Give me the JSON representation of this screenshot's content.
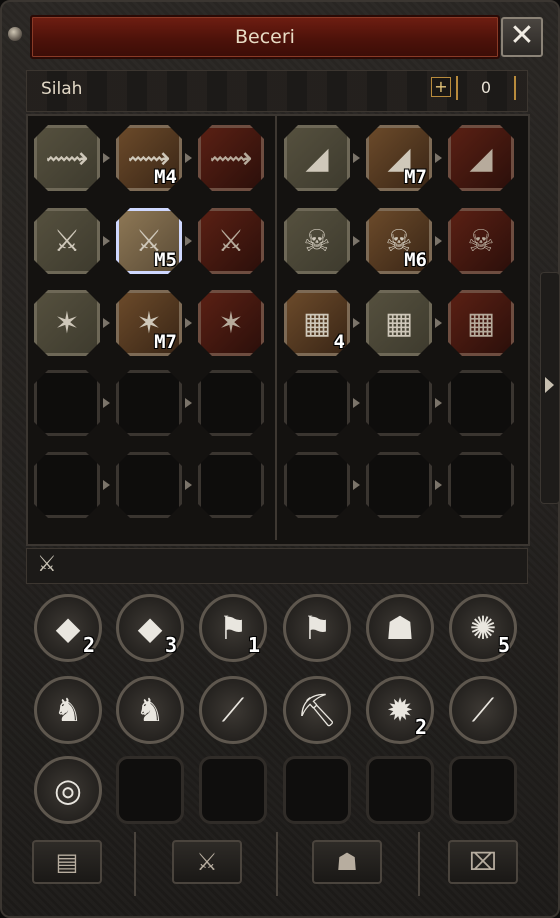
{
  "window": {
    "title": "Beceri",
    "close_glyph": "✕"
  },
  "category": {
    "label": "Silah",
    "plus_glyph": "+",
    "points": "0"
  },
  "left_tree": [
    [
      {
        "icon": "claw-icon",
        "glyph": "⟿",
        "style": "olive",
        "level": ""
      },
      {
        "icon": "claw-icon",
        "glyph": "⟿",
        "style": "orange",
        "level": "M4"
      },
      {
        "icon": "claw-icon",
        "glyph": "⟿",
        "style": "red",
        "level": ""
      }
    ],
    [
      {
        "icon": "sword-icon",
        "glyph": "⚔",
        "style": "olive",
        "level": ""
      },
      {
        "icon": "sword-icon",
        "glyph": "⚔",
        "style": "selected",
        "level": "M5"
      },
      {
        "icon": "sword-icon",
        "glyph": "⚔",
        "style": "red",
        "level": ""
      }
    ],
    [
      {
        "icon": "emblem-icon",
        "glyph": "✶",
        "style": "olive",
        "level": ""
      },
      {
        "icon": "emblem-icon",
        "glyph": "✶",
        "style": "orange",
        "level": "M7"
      },
      {
        "icon": "emblem-icon",
        "glyph": "✶",
        "style": "red",
        "level": ""
      }
    ]
  ],
  "right_tree": [
    [
      {
        "icon": "net-icon",
        "glyph": "◢",
        "style": "olive",
        "level": ""
      },
      {
        "icon": "net-icon",
        "glyph": "◢",
        "style": "orange",
        "level": "M7"
      },
      {
        "icon": "net-icon",
        "glyph": "◢",
        "style": "red",
        "level": ""
      }
    ],
    [
      {
        "icon": "skull-icon",
        "glyph": "☠",
        "style": "olive",
        "level": ""
      },
      {
        "icon": "skull-icon",
        "glyph": "☠",
        "style": "orange",
        "level": "M6"
      },
      {
        "icon": "skull-icon",
        "glyph": "☠",
        "style": "red",
        "level": ""
      }
    ],
    [
      {
        "icon": "rune-icon",
        "glyph": "▦",
        "style": "orange",
        "level": "4"
      },
      {
        "icon": "rune-icon",
        "glyph": "▦",
        "style": "olive",
        "level": ""
      },
      {
        "icon": "rune-icon",
        "glyph": "▦",
        "style": "red",
        "level": ""
      }
    ]
  ],
  "support_skills": [
    {
      "name": "book-red-skill",
      "icon": "red-book-icon",
      "glyph": "◆",
      "level": "2"
    },
    {
      "name": "book-yellow-skill",
      "icon": "yellow-book-icon",
      "glyph": "◆",
      "level": "3"
    },
    {
      "name": "flag-skill",
      "icon": "flag-icon",
      "glyph": "⚑",
      "level": "1"
    },
    {
      "name": "flag-up-skill",
      "icon": "flag-up-icon",
      "glyph": "⚑",
      "level": ""
    },
    {
      "name": "group-skill",
      "icon": "group-icon",
      "glyph": "☗",
      "level": ""
    },
    {
      "name": "swirl-skill",
      "icon": "swirl-icon",
      "glyph": "✺",
      "level": "5"
    },
    {
      "name": "horse-skill",
      "icon": "horse-icon",
      "glyph": "♞",
      "level": ""
    },
    {
      "name": "horse-circle-skill",
      "icon": "horse-circle-icon",
      "glyph": "♞",
      "level": ""
    },
    {
      "name": "fishing-skill",
      "icon": "fishing-rod-icon",
      "glyph": "⟋",
      "level": ""
    },
    {
      "name": "mining-skill",
      "icon": "pickaxe-icon",
      "glyph": "⛏",
      "level": ""
    },
    {
      "name": "claw-strike-skill",
      "icon": "claw-strike-icon",
      "glyph": "✹",
      "level": "2"
    },
    {
      "name": "locked-skill",
      "icon": "locked-sword-icon",
      "glyph": "⟋",
      "level": ""
    },
    {
      "name": "target-skill",
      "icon": "target-icon",
      "glyph": "◎",
      "level": ""
    }
  ],
  "bottom_tabs": [
    {
      "name": "tab-character",
      "icon": "id-card-icon",
      "glyph": "▤"
    },
    {
      "name": "tab-skills",
      "icon": "sword-icon",
      "glyph": "⚔"
    },
    {
      "name": "tab-emotes",
      "icon": "figure-icon",
      "glyph": "☗"
    },
    {
      "name": "tab-quests",
      "icon": "scroll-icon",
      "glyph": "⌧"
    }
  ],
  "colors": {
    "title_bg": "#6f1e12",
    "accent_gold": "#b98b3c",
    "text": "#e8dcc5"
  }
}
